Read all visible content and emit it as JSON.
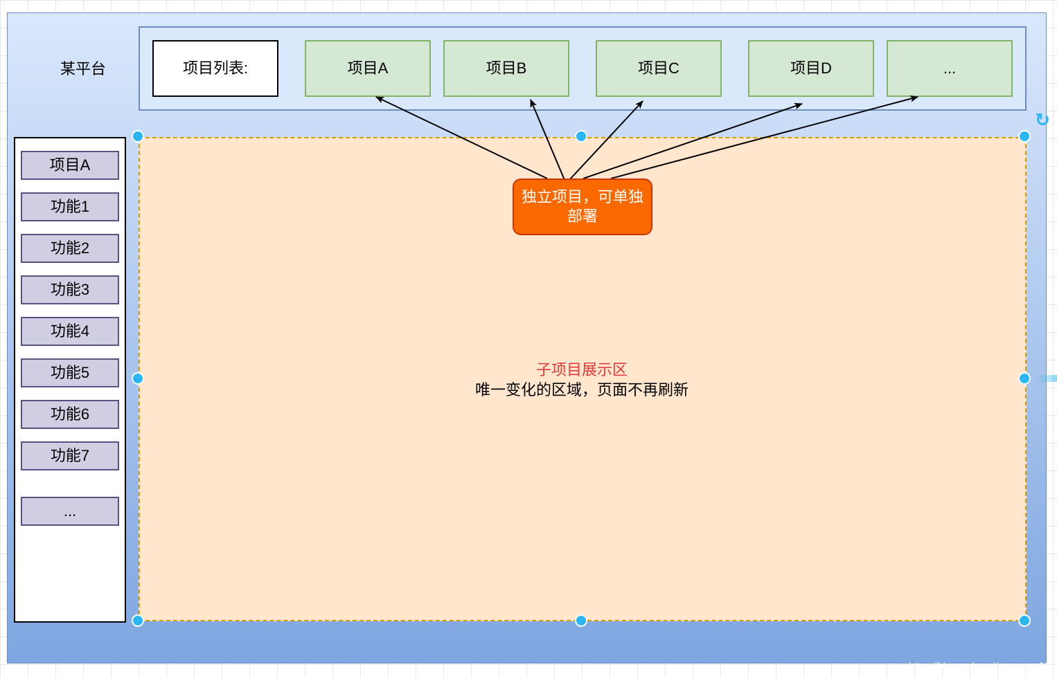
{
  "platform": {
    "label": "某平台"
  },
  "topbar": {
    "list_label": "项目列表:",
    "projects": [
      "项目A",
      "项目B",
      "项目C",
      "项目D",
      "..."
    ]
  },
  "sidebar": {
    "items": [
      "项目A",
      "功能1",
      "功能2",
      "功能3",
      "功能4",
      "功能5",
      "功能6",
      "功能7",
      "..."
    ]
  },
  "badge": {
    "text_line1": "独立项目，可单独",
    "text_line2": "部署"
  },
  "content": {
    "title": "子项目展示区",
    "description": "唯一变化的区域，页面不再刷新"
  },
  "colors": {
    "platform_fill_top": "#dae8fc",
    "platform_fill_bottom": "#7ea6e0",
    "project_fill": "#d5e8d4",
    "project_border": "#82b366",
    "sidebar_item_fill": "#d0cee2",
    "content_fill": "#ffe6cc",
    "badge_fill": "#fa6800",
    "content_title_color": "#e3393a",
    "handle_color": "#29b6f2"
  },
  "watermark": "https://blog.csdn.net/gaomeng068"
}
